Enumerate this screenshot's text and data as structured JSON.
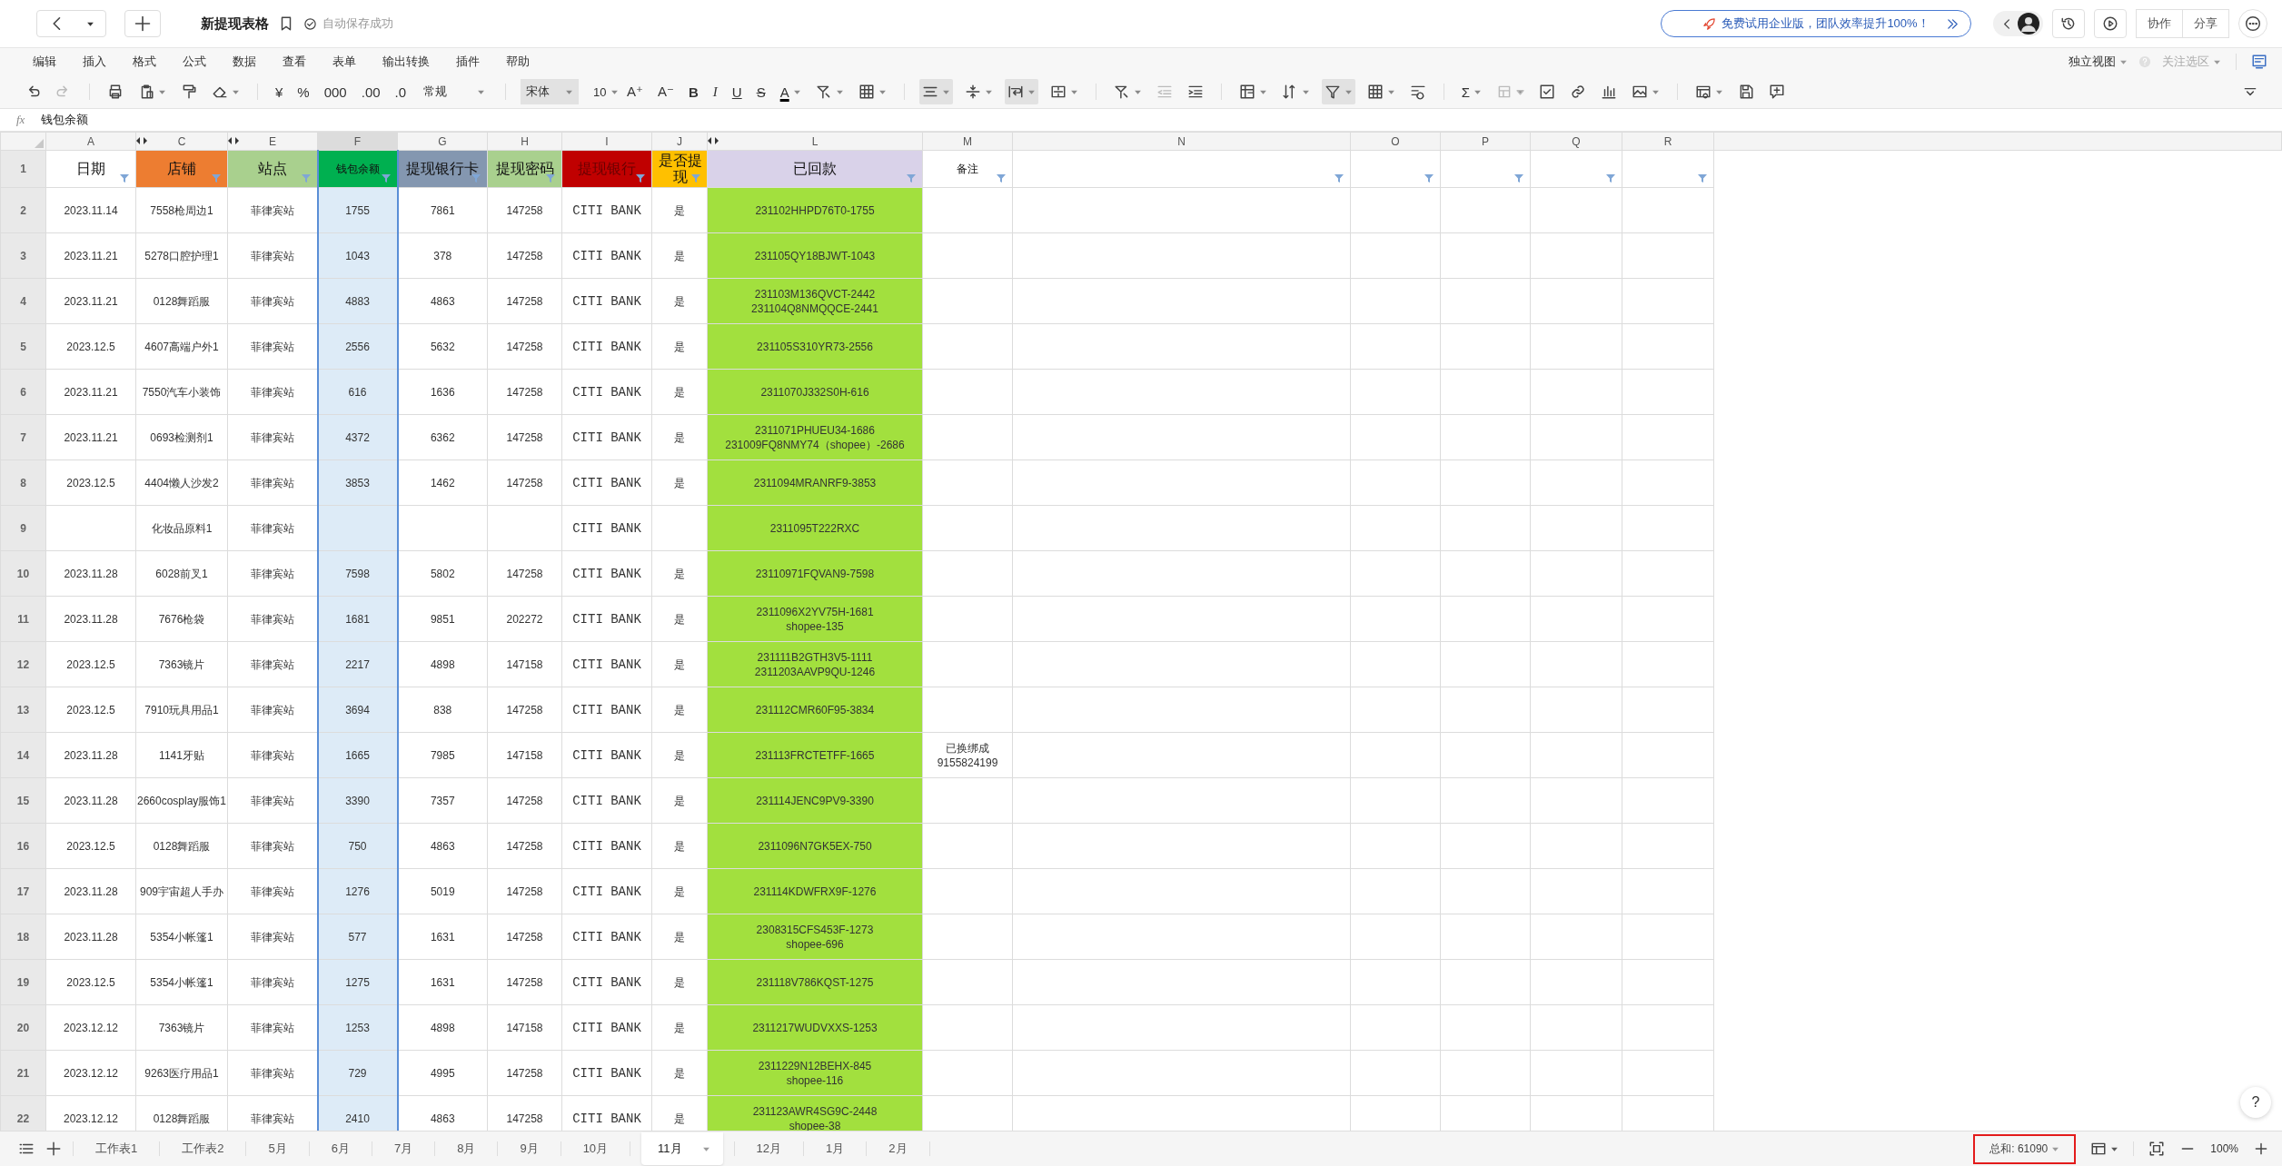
{
  "document": {
    "title": "新提现表格",
    "save_status": "自动保存成功"
  },
  "promo_banner": "免费试用企业版，团队效率提升100%！",
  "top_buttons": [
    "协作",
    "分享"
  ],
  "menu": [
    "编辑",
    "插入",
    "格式",
    "公式",
    "数据",
    "查看",
    "表单",
    "输出转换",
    "插件",
    "帮助"
  ],
  "view_options": [
    {
      "label": "独立视图",
      "disabled": false
    },
    {
      "label": "关注选区",
      "disabled": true
    }
  ],
  "toolbar": {
    "currency": "¥",
    "percent": "%",
    "thousands": "000",
    "add_decimal": ".00",
    "remove_decimal": ".0",
    "number_format": "常规",
    "font": "宋体",
    "font_size": "10",
    "grow_font": "A⁺",
    "shrink_font": "A⁻",
    "bold": "B",
    "italic": "I",
    "underline": "U",
    "strike": "S",
    "font_color": "A",
    "sum": "Σ"
  },
  "formula_bar": {
    "label": "fx",
    "value": "钱包余额"
  },
  "columns": [
    {
      "letter": "A",
      "header": "日期",
      "color": "#ffffff",
      "selected": false,
      "hidden_before": false
    },
    {
      "letter": "C",
      "header": "店铺",
      "color": "#ed7d31",
      "selected": false,
      "hidden_before": true
    },
    {
      "letter": "E",
      "header": "站点",
      "color": "#a9d08e",
      "selected": false,
      "hidden_before": true
    },
    {
      "letter": "F",
      "header": "钱包余额",
      "color": "#00b050",
      "selected": true,
      "hidden_before": false
    },
    {
      "letter": "G",
      "header": "提现银行卡",
      "color": "#8497b0",
      "selected": false,
      "hidden_before": false
    },
    {
      "letter": "H",
      "header": "提现密码",
      "color": "#a9d08e",
      "selected": false,
      "hidden_before": false
    },
    {
      "letter": "I",
      "header": "提现银行",
      "color": "#c00000",
      "selected": false,
      "hidden_before": false
    },
    {
      "letter": "J",
      "header": "是否提现",
      "color": "#ffc000",
      "selected": false,
      "hidden_before": false
    },
    {
      "letter": "L",
      "header": "已回款",
      "color": "#d9d2e9",
      "cell_fill": {
        "color": "#a2e03e"
      },
      "selected": false,
      "hidden_before": true
    },
    {
      "letter": "M",
      "header": "备注",
      "color": "#ffffff",
      "selected": false,
      "hidden_before": false
    },
    {
      "letter": "N",
      "color": "#ffffff",
      "selected": false,
      "hidden_before": false
    },
    {
      "letter": "O",
      "color": "#ffffff",
      "selected": false,
      "hidden_before": false
    },
    {
      "letter": "P",
      "color": "#ffffff",
      "selected": false,
      "hidden_before": false
    },
    {
      "letter": "Q",
      "color": "#ffffff",
      "selected": false,
      "hidden_before": false
    },
    {
      "letter": "R",
      "color": "#ffffff",
      "selected": false,
      "hidden_before": false
    }
  ],
  "header_row_number": "1",
  "rows": [
    {
      "number": "2",
      "cells": [
        "2023.11.14",
        "7558枪周边1",
        "菲律宾站",
        "1755",
        "7861",
        "147258",
        "CITI BANK",
        "是",
        "231102HHPD76T0-1755",
        null
      ]
    },
    {
      "number": "3",
      "cells": [
        "2023.11.21",
        "5278口腔护理1",
        "菲律宾站",
        "1043",
        "378",
        "147258",
        "CITI BANK",
        "是",
        "231105QY18BJWT-1043",
        null
      ]
    },
    {
      "number": "4",
      "cells": [
        "2023.11.21",
        "0128舞蹈服",
        "菲律宾站",
        "4883",
        "4863",
        "147258",
        "CITI BANK",
        "是",
        "231103M136QVCT-2442\n231104Q8NMQQCE-2441",
        null
      ]
    },
    {
      "number": "5",
      "cells": [
        "2023.12.5",
        "4607高端户外1",
        "菲律宾站",
        "2556",
        "5632",
        "147258",
        "CITI BANK",
        "是",
        "231105S310YR73-2556",
        null
      ]
    },
    {
      "number": "6",
      "cells": [
        "2023.11.21",
        "7550汽车小装饰",
        "菲律宾站",
        "616",
        "1636",
        "147258",
        "CITI BANK",
        "是",
        "2311070J332S0H-616",
        null
      ]
    },
    {
      "number": "7",
      "cells": [
        "2023.11.21",
        "0693检测剂1",
        "菲律宾站",
        "4372",
        "6362",
        "147258",
        "CITI BANK",
        "是",
        "2311071PHUEU34-1686\n231009FQ8NMY74（shopee）-2686",
        null
      ]
    },
    {
      "number": "8",
      "cells": [
        "2023.12.5",
        "4404懒人沙发2",
        "菲律宾站",
        "3853",
        "1462",
        "147258",
        "CITI BANK",
        "是",
        "2311094MRANRF9-3853",
        null
      ]
    },
    {
      "number": "9",
      "cells": [
        null,
        "化妆品原料1",
        "菲律宾站",
        null,
        null,
        null,
        "CITI BANK",
        null,
        "2311095T222RXC",
        null
      ]
    },
    {
      "number": "10",
      "cells": [
        "2023.11.28",
        "6028前叉1",
        "菲律宾站",
        "7598",
        "5802",
        "147258",
        "CITI BANK",
        "是",
        "23110971FQVAN9-7598",
        null
      ]
    },
    {
      "number": "11",
      "cells": [
        "2023.11.28",
        "7676枪袋",
        "菲律宾站",
        "1681",
        "9851",
        "202272",
        "CITI BANK",
        "是",
        "2311096X2YV75H-1681\nshopee-135",
        null
      ]
    },
    {
      "number": "12",
      "cells": [
        "2023.12.5",
        "7363镜片",
        "菲律宾站",
        "2217",
        "4898",
        "147158",
        "CITI BANK",
        "是",
        "231111B2GTH3V5-1111\n2311203AAVP9QU-1246",
        null
      ]
    },
    {
      "number": "13",
      "cells": [
        "2023.12.5",
        "7910玩具用品1",
        "菲律宾站",
        "3694",
        "838",
        "147258",
        "CITI BANK",
        "是",
        "231112CMR60F95-3834",
        null
      ]
    },
    {
      "number": "14",
      "cells": [
        "2023.11.28",
        "1141牙贴",
        "菲律宾站",
        "1665",
        "7985",
        "147158",
        "CITI BANK",
        "是",
        "231113FRCTETFF-1665",
        "已换绑成\n9155824199"
      ]
    },
    {
      "number": "15",
      "cells": [
        "2023.11.28",
        "2660cosplay服饰1",
        "菲律宾站",
        "3390",
        "7357",
        "147258",
        "CITI BANK",
        "是",
        "231114JENC9PV9-3390",
        null
      ]
    },
    {
      "number": "16",
      "cells": [
        "2023.12.5",
        "0128舞蹈服",
        "菲律宾站",
        "750",
        "4863",
        "147258",
        "CITI BANK",
        "是",
        "2311096N7GK5EX-750",
        null
      ]
    },
    {
      "number": "17",
      "cells": [
        "2023.11.28",
        "909宇宙超人手办",
        "菲律宾站",
        "1276",
        "5019",
        "147258",
        "CITI BANK",
        "是",
        "231114KDWFRX9F-1276",
        null
      ]
    },
    {
      "number": "18",
      "cells": [
        "2023.11.28",
        "5354小帐篷1",
        "菲律宾站",
        "577",
        "1631",
        "147258",
        "CITI BANK",
        "是",
        "2308315CFS453F-1273\nshopee-696",
        null
      ]
    },
    {
      "number": "19",
      "cells": [
        "2023.12.5",
        "5354小帐篷1",
        "菲律宾站",
        "1275",
        "1631",
        "147258",
        "CITI BANK",
        "是",
        "231118V786KQST-1275",
        null
      ]
    },
    {
      "number": "20",
      "cells": [
        "2023.12.12",
        "7363镜片",
        "菲律宾站",
        "1253",
        "4898",
        "147158",
        "CITI BANK",
        "是",
        "2311217WUDVXXS-1253",
        null
      ]
    },
    {
      "number": "21",
      "cells": [
        "2023.12.12",
        "9263医疗用品1",
        "菲律宾站",
        "729",
        "4995",
        "147258",
        "CITI BANK",
        "是",
        "2311229N12BEHX-845\nshopee-116",
        null
      ]
    },
    {
      "number": "22",
      "cells": [
        "2023.12.12",
        "0128舞蹈服",
        "菲律宾站",
        "2410",
        "4863",
        "147258",
        "CITI BANK",
        "是",
        "231123AWR4SG9C-2448\nshopee-38",
        null
      ]
    }
  ],
  "sheet_tabs": [
    {
      "label": "工作表1",
      "selected": false
    },
    {
      "label": "工作表2",
      "selected": false
    },
    {
      "label": "5月",
      "selected": false
    },
    {
      "label": "6月",
      "selected": false
    },
    {
      "label": "7月",
      "selected": false
    },
    {
      "label": "8月",
      "selected": false
    },
    {
      "label": "9月",
      "selected": false
    },
    {
      "label": "10月",
      "selected": false
    },
    {
      "label": "11月",
      "selected": true
    },
    {
      "label": "12月",
      "selected": false
    },
    {
      "label": "1月",
      "selected": false
    },
    {
      "label": "2月",
      "selected": false
    }
  ],
  "status_bar": {
    "sum": "总和: 61090",
    "highlighted": true,
    "zoom": "100%"
  },
  "help": "?"
}
